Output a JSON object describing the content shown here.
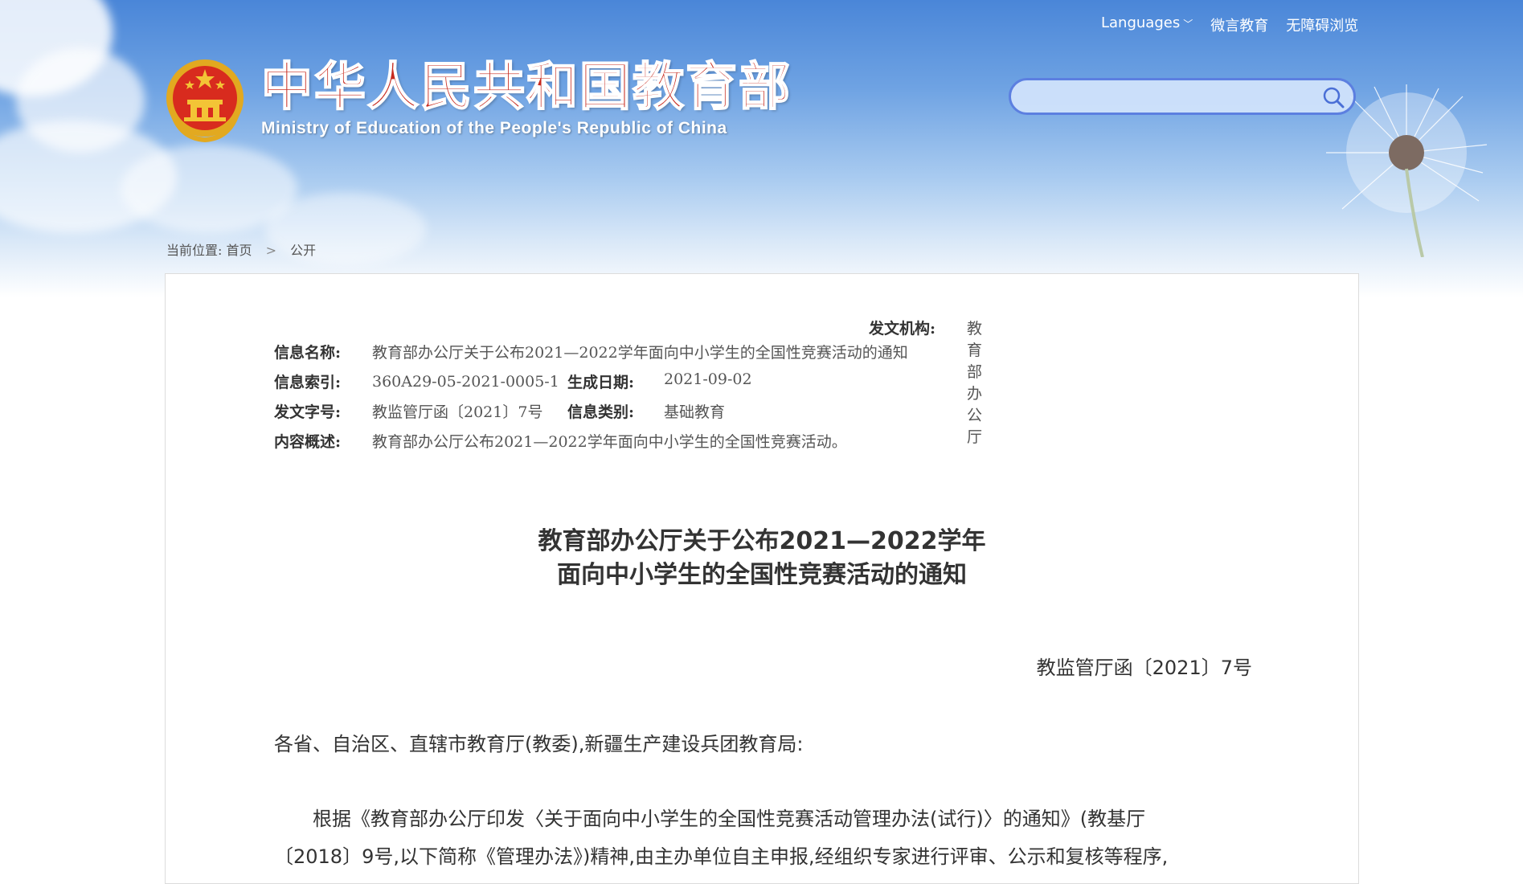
{
  "header": {
    "links": {
      "languages": "Languages",
      "weiyan": "微言教育",
      "accessibility": "无障碍浏览"
    },
    "site_title_cn": "中华人民共和国教育部",
    "site_title_en": "Ministry of Education of the People's Republic of China",
    "search": {
      "placeholder": "",
      "value": ""
    }
  },
  "breadcrumb": {
    "prefix": "当前位置:",
    "home": "首页",
    "separator": ">",
    "current": "公开"
  },
  "info": {
    "name_label": "信息名称:",
    "name_value": "教育部办公厅关于公布2021—2022学年面向中小学生的全国性竞赛活动的通知",
    "index_label": "信息索引:",
    "index_value": "360A29-05-2021-0005-1",
    "date_label": "生成日期:",
    "date_value": "2021-09-02",
    "org_label": "发文机构:",
    "org_value": "教育部办公厅",
    "docno_label": "发文字号:",
    "docno_value": "教监管厅函〔2021〕7号",
    "category_label": "信息类别:",
    "category_value": "基础教育",
    "summary_label": "内容概述:",
    "summary_value": "教育部办公厅公布2021—2022学年面向中小学生的全国性竞赛活动。"
  },
  "document": {
    "title_line1": "教育部办公厅关于公布2021—2022学年",
    "title_line2": "面向中小学生的全国性竞赛活动的通知",
    "number": "教监管厅函〔2021〕7号",
    "addressee": "各省、自治区、直辖市教育厅(教委),新疆生产建设兵团教育局:",
    "para1_line1": "根据《教育部办公厅印发〈关于面向中小学生的全国性竞赛活动管理办法(试行)〉的通知》(教基厅",
    "para1_line2": "〔2018〕9号,以下简称《管理办法》)精神,由主办单位自主申报,经组织专家进行评审、公示和复核等程序,"
  },
  "colors": {
    "title_red": "#c72a1e",
    "banner_blue": "#4a86d8",
    "search_border": "#5c7fe0"
  }
}
